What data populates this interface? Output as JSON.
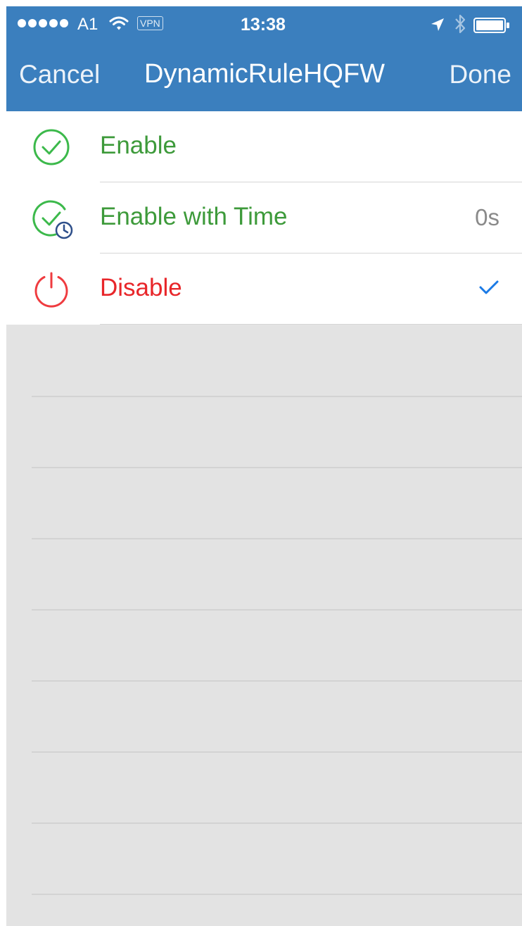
{
  "status_bar": {
    "carrier": "A1",
    "vpn": "VPN",
    "time": "13:38",
    "signal_icon": "signal-dots-icon",
    "wifi_icon": "wifi-icon",
    "location_icon": "location-arrow-icon",
    "bluetooth_icon": "bluetooth-icon",
    "battery_icon": "battery-icon"
  },
  "nav": {
    "cancel_label": "Cancel",
    "title": "DynamicRuleHQFW",
    "done_label": "Done",
    "background_color": "#3b7fbe"
  },
  "options": [
    {
      "label": "Enable",
      "icon": "check-circle-icon",
      "color": "#3d9a3a",
      "detail": "",
      "selected": false
    },
    {
      "label": "Enable with Time",
      "icon": "check-circle-clock-icon",
      "color": "#3d9a3a",
      "detail": "0s",
      "selected": false
    },
    {
      "label": "Disable",
      "icon": "power-icon",
      "color": "#e8262a",
      "detail": "",
      "selected": true
    }
  ],
  "selected_marker_icon": "checkmark-icon",
  "accent_color": "#1a7ae6",
  "background_color": "#e3e3e3"
}
